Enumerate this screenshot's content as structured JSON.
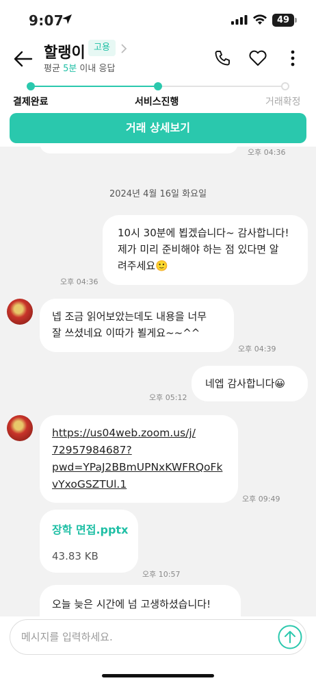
{
  "status_bar": {
    "time": "9:07",
    "battery": "49"
  },
  "header": {
    "name": "할랭이",
    "badge": "고용",
    "response_prefix": "평균 ",
    "response_highlight": "5분",
    "response_suffix": " 이내 응답",
    "accent_color": "#2ac8ad"
  },
  "progress": {
    "steps": [
      {
        "label": "결제완료",
        "state": "done"
      },
      {
        "label": "서비스진행",
        "state": "current"
      },
      {
        "label": "거래확정",
        "state": "pending"
      }
    ]
  },
  "detail_button": {
    "label": "거래 상세보기"
  },
  "chat": {
    "top_partial_time": "오후 04:36",
    "date_separator": "2024년 4월 16일 화요일",
    "messages": [
      {
        "side": "me",
        "lines": [
          "10시 30분에 뵙겠습니다~ 감사합니다!",
          "제가 미리 준비해야 하는 점 있다면 알",
          "려주세요🙂"
        ],
        "time": "오후 04:36"
      },
      {
        "side": "them",
        "lines": [
          "넵 조금 읽어보았는데도 내용을 너무",
          "잘 쓰셨네요 이따가 뵐게요~~^^"
        ],
        "time": "오후 04:39"
      },
      {
        "side": "me",
        "lines": [
          "네엡 감사합니다😀"
        ],
        "time": "오후 05:12"
      },
      {
        "side": "them",
        "link": [
          "https://us04web.zoom.us/j/",
          "72957984687?",
          "pwd=YPaJ2BBmUPNxKWFRQoFk",
          "vYxoGSZTUl.1"
        ],
        "time": "오후 09:49"
      },
      {
        "side": "them",
        "file_name": "장학 면접.pptx",
        "file_size": "43.83 KB",
        "time": "오후 10:57"
      },
      {
        "side": "them",
        "lines": [
          "오늘 늦은 시간에 넘 고생하셨습니다!"
        ]
      }
    ]
  },
  "input": {
    "placeholder": "메시지를 입력하세요."
  }
}
